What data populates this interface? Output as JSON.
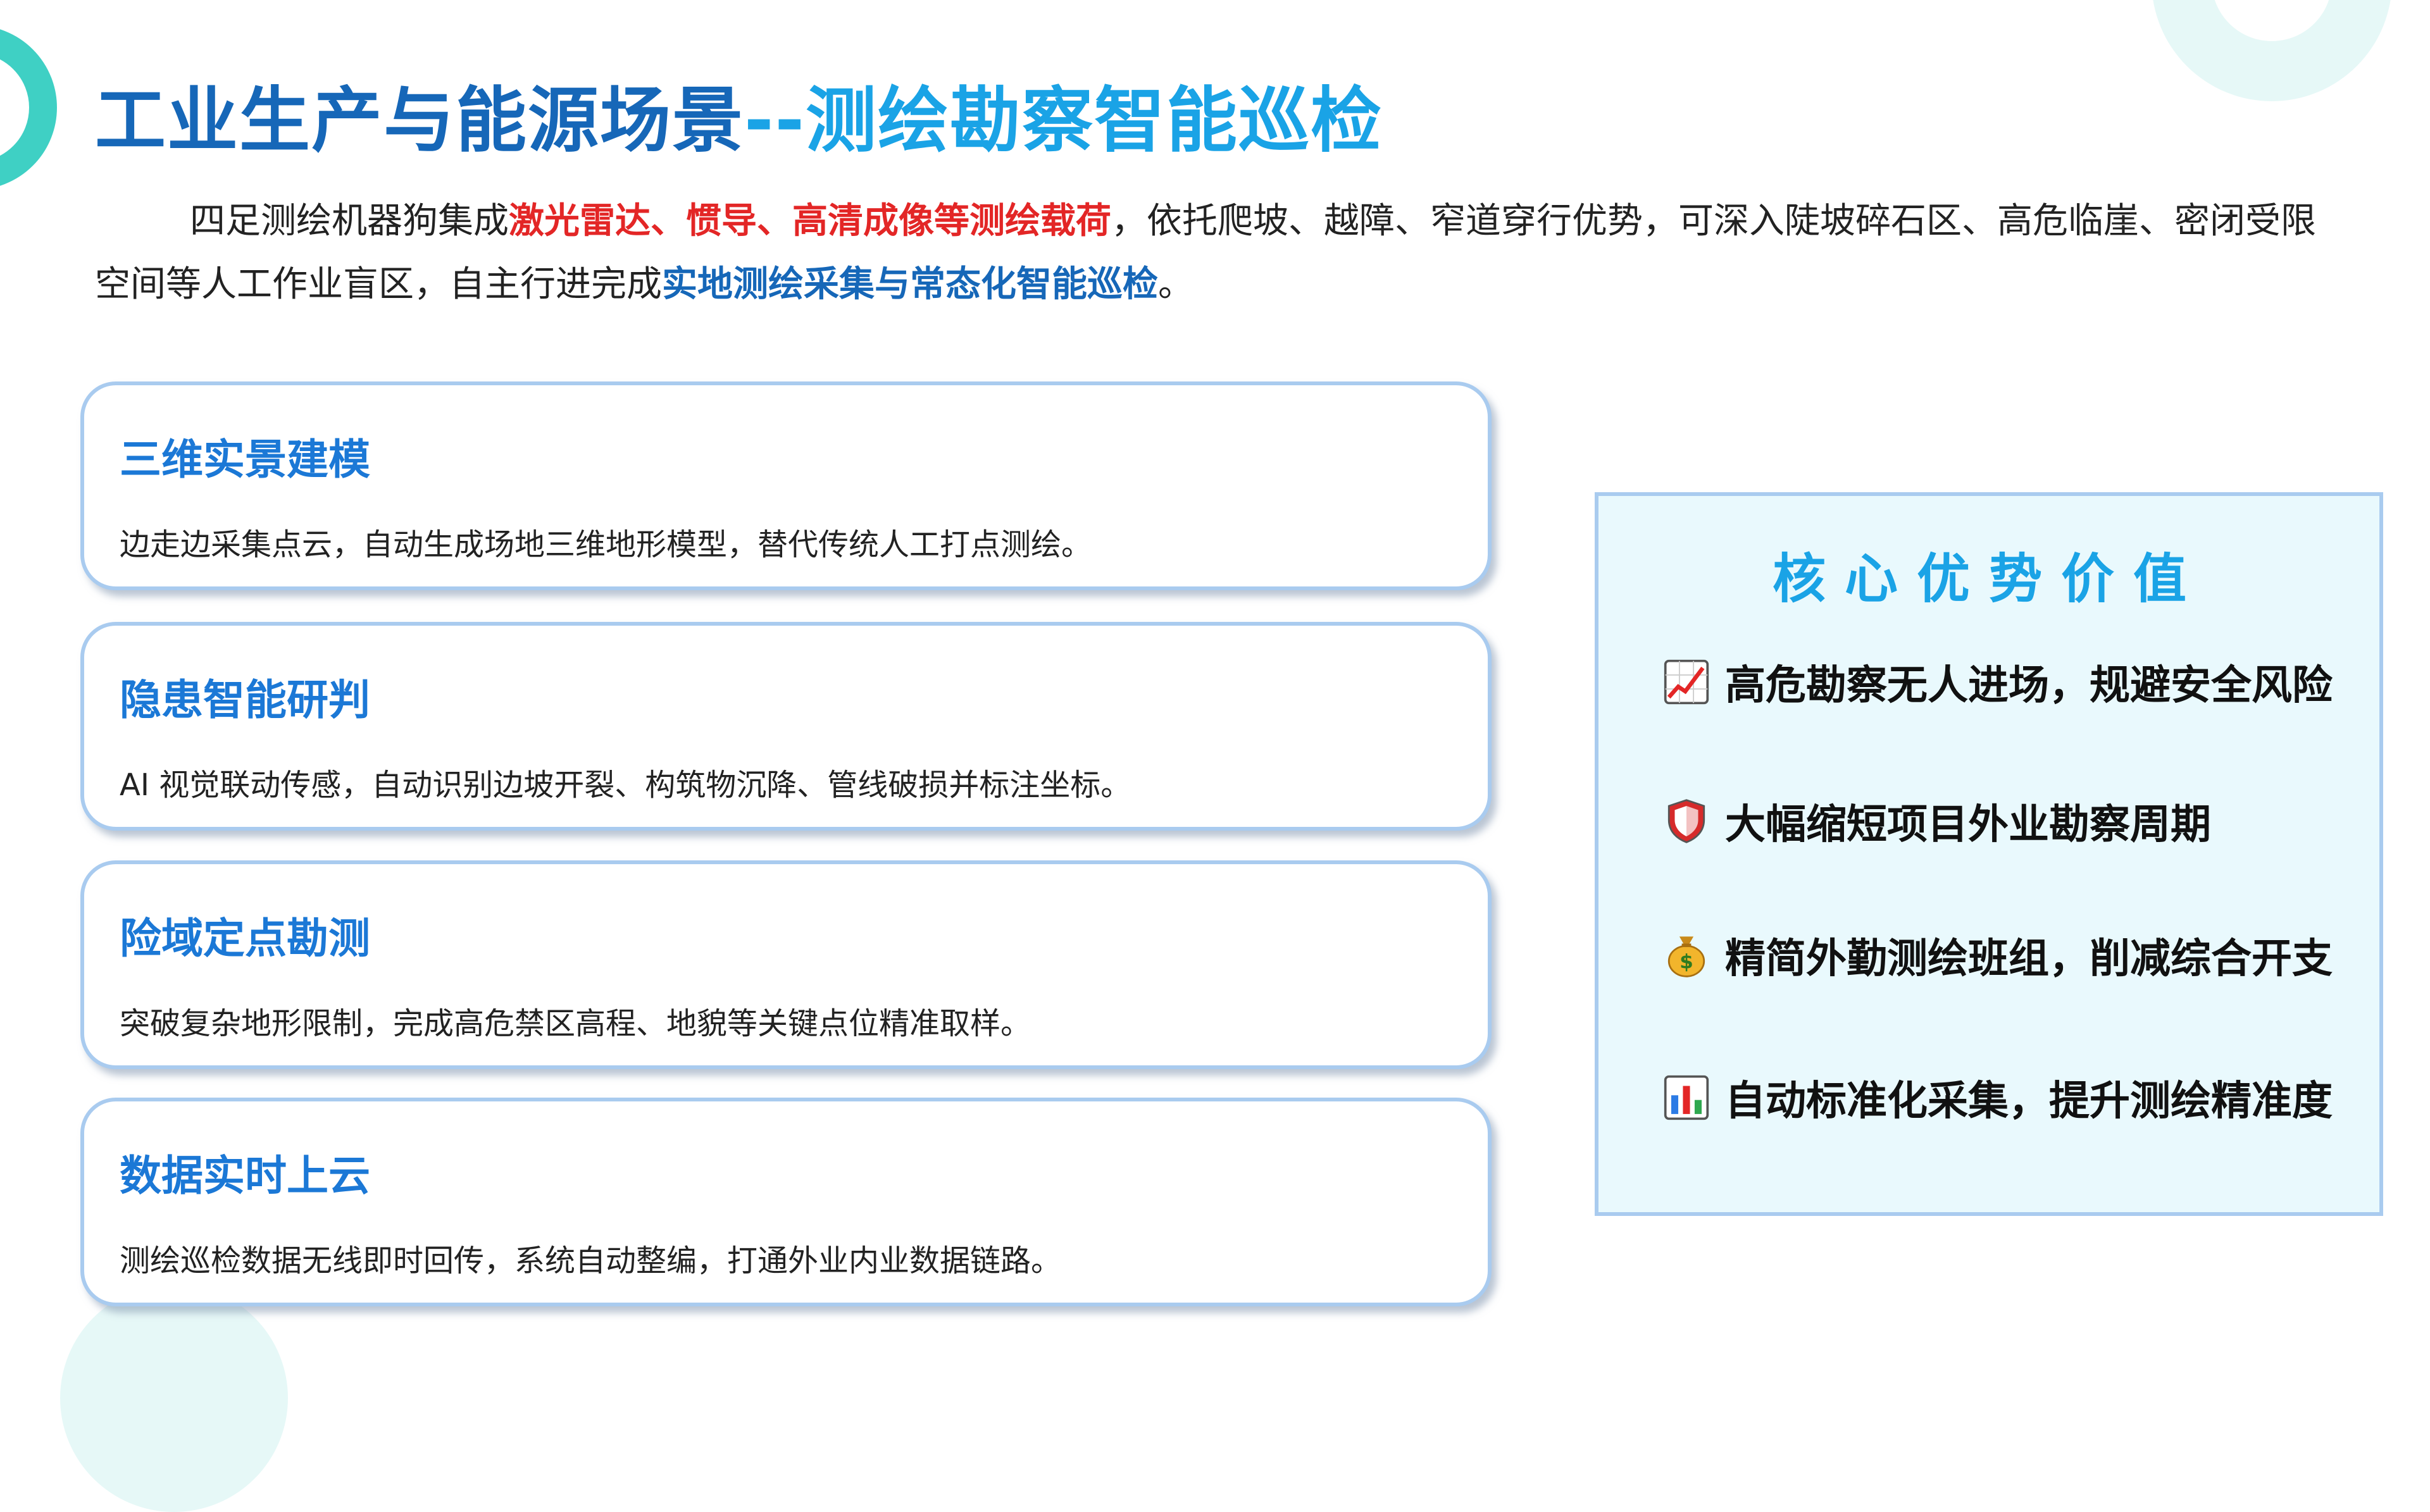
{
  "title": {
    "part1": "工业生产与能源场景",
    "part2": "--测绘勘察智能巡检"
  },
  "intro": {
    "p1": "四足测绘机器狗集成",
    "p2_highlight": "激光雷达、惯导、高清成像等测绘载荷",
    "p3": "，依托爬坡、越障、窄道穿行优势，可深入陡坡碎石区、高危临崖、密闭受限空间等人工作业盲区，自主行进完成",
    "p4_highlight": "实地测绘采集与常态化智能巡检",
    "p5": "。"
  },
  "cards": [
    {
      "title": "三维实景建模",
      "desc": "边走边采集点云，自动生成场地三维地形模型，替代传统人工打点测绘。"
    },
    {
      "title": "隐患智能研判",
      "desc": "AI 视觉联动传感，自动识别边坡开裂、构筑物沉降、管线破损并标注坐标。"
    },
    {
      "title": "险域定点勘测",
      "desc": "突破复杂地形限制，完成高危禁区高程、地貌等关键点位精准取样。"
    },
    {
      "title": "数据实时上云",
      "desc": "测绘巡检数据无线即时回传，系统自动整编，打通外业内业数据链路。"
    }
  ],
  "panel": {
    "title": "核心优势价值",
    "items": [
      {
        "icon": "chart-increasing-icon",
        "text": "高危勘察无人进场，规避安全风险"
      },
      {
        "icon": "shield-icon",
        "text": "大幅缩短项目外业勘察周期"
      },
      {
        "icon": "money-bag-icon",
        "text": "精简外勤测绘班组，削减综合开支"
      },
      {
        "icon": "bar-chart-icon",
        "text": "自动标准化采集，提升测绘精准度"
      }
    ]
  },
  "colors": {
    "title_dark": "#1667b8",
    "title_light": "#1aa3e6",
    "highlight_red": "#e32626",
    "card_border": "#a9cbef",
    "panel_bg": "#e9f9fd",
    "accent_teal": "#3fd0c4"
  }
}
